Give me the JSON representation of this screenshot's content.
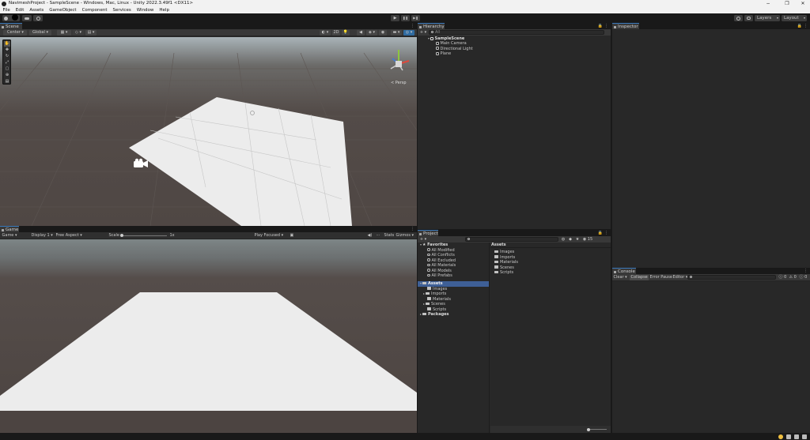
{
  "window": {
    "title": "NavimeshProject - SampleScene - Windows, Mac, Linux - Unity 2022.3.49f1 <DX11>",
    "minimize_glyph": "−",
    "maximize_glyph": "❐",
    "close_glyph": "✕"
  },
  "menu": [
    "File",
    "Edit",
    "Assets",
    "GameObject",
    "Component",
    "Services",
    "Window",
    "Help"
  ],
  "toolbar": {
    "play_glyph": "▶",
    "pause_glyph": "❚❚",
    "step_glyph": "▶❚",
    "layers_label": "Layers",
    "layout_label": "Layout"
  },
  "scene": {
    "tab_label": "Scene",
    "pivot_label": "Center",
    "space_label": "Global",
    "mode_2d": "2D",
    "persp_label": "< Persp"
  },
  "game": {
    "tab_label": "Game",
    "mode_label": "Game",
    "display_label": "Display 1",
    "aspect_label": "Free Aspect",
    "scale_label": "Scale",
    "scale_value": "1x",
    "play_focused_label": "Play Focused",
    "stats_label": "Stats",
    "gizmos_label": "Gizmos"
  },
  "hierarchy": {
    "tab_label": "Hierarchy",
    "add_label": "+",
    "search_placeholder": "All",
    "scene_name": "SampleScene",
    "items": [
      "Main Camera",
      "Directional Light",
      "Plane"
    ]
  },
  "inspector": {
    "tab_label": "Inspector"
  },
  "project": {
    "tab_label": "Project",
    "add_label": "+",
    "hidden_count": "15",
    "favorites_label": "Favorites",
    "favorites": [
      "All Modified",
      "All Conflicts",
      "All Excluded",
      "All Materials",
      "All Models",
      "All Prefabs"
    ],
    "assets_label": "Assets",
    "asset_folders": [
      "Images",
      "Imports",
      "Materials",
      "Scenes",
      "Scripts"
    ],
    "packages_label": "Packages",
    "breadcrumb": "Assets",
    "grid_items": [
      "Images",
      "Imports",
      "Materials",
      "Scenes",
      "Scripts"
    ]
  },
  "console": {
    "tab_label": "Console",
    "clear_label": "Clear",
    "collapse_label": "Collapse",
    "error_pause_label": "Error Pause",
    "editor_label": "Editor",
    "log_count": "0",
    "warn_count": "0",
    "error_count": "0"
  },
  "colors": {
    "selection": "#3e5f96",
    "panel_bg": "#282828",
    "tab_accent": "#3a79bb",
    "sky_top": "#7e8585",
    "ground": "#4d4643",
    "plane": "#ececec"
  }
}
